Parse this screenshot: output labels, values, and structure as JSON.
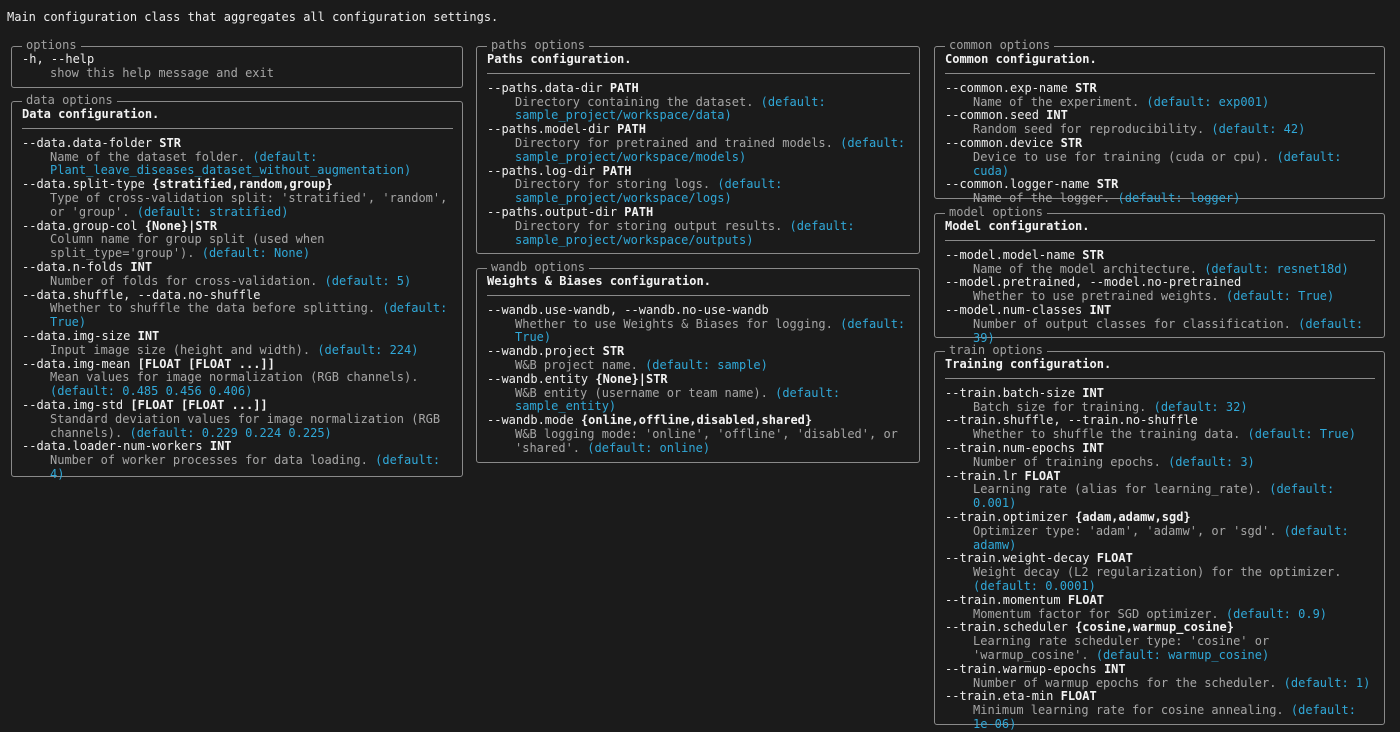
{
  "intro": "Main configuration class that aggregates all configuration settings.",
  "colors": {
    "background": "#1b1b1b",
    "text": "#dcdcdc",
    "default": "#30a8d8",
    "border": "#8a8a8a"
  },
  "options": {
    "title": "options",
    "items": [
      {
        "flag": "-h, --help",
        "metavar": "",
        "help": "show this help message and exit",
        "def": ""
      }
    ]
  },
  "data": {
    "title": "data options",
    "description": "Data configuration.",
    "items": [
      {
        "flag": "--data.data-folder",
        "metavar": "STR",
        "help": "Name of the dataset folder.",
        "def": "(default: Plant_leave_diseases_dataset_without_augmentation)"
      },
      {
        "flag": "--data.split-type",
        "metavar": "{stratified,random,group}",
        "help": "Type of cross-validation split: 'stratified', 'random', or 'group'.",
        "def": "(default: stratified)"
      },
      {
        "flag": "--data.group-col",
        "metavar": "{None}|STR",
        "help": "Column name for group split (used when split_type='group').",
        "def": "(default: None)"
      },
      {
        "flag": "--data.n-folds",
        "metavar": "INT",
        "help": "Number of folds for cross-validation.",
        "def": "(default: 5)"
      },
      {
        "flag": "--data.shuffle, --data.no-shuffle",
        "metavar": "",
        "help": "Whether to shuffle the data before splitting.",
        "def": "(default: True)"
      },
      {
        "flag": "--data.img-size",
        "metavar": "INT",
        "help": "Input image size (height and width).",
        "def": "(default: 224)"
      },
      {
        "flag": "--data.img-mean",
        "metavar": "[FLOAT [FLOAT ...]]",
        "help": "Mean values for image normalization (RGB channels).",
        "def": "(default: 0.485 0.456 0.406)"
      },
      {
        "flag": "--data.img-std",
        "metavar": "[FLOAT [FLOAT ...]]",
        "help": "Standard deviation values for image normalization (RGB channels).",
        "def": "(default: 0.229 0.224 0.225)"
      },
      {
        "flag": "--data.loader-num-workers",
        "metavar": "INT",
        "help": "Number of worker processes for data loading.",
        "def": "(default: 4)"
      }
    ]
  },
  "paths": {
    "title": "paths options",
    "description": "Paths configuration.",
    "items": [
      {
        "flag": "--paths.data-dir",
        "metavar": "PATH",
        "help": "Directory containing the dataset.",
        "def": "(default: sample_project/workspace/data)"
      },
      {
        "flag": "--paths.model-dir",
        "metavar": "PATH",
        "help": "Directory for pretrained and trained models.",
        "def": "(default: sample_project/workspace/models)"
      },
      {
        "flag": "--paths.log-dir",
        "metavar": "PATH",
        "help": "Directory for storing logs.",
        "def": "(default: sample_project/workspace/logs)"
      },
      {
        "flag": "--paths.output-dir",
        "metavar": "PATH",
        "help": "Directory for storing output results.",
        "def": "(default: sample_project/workspace/outputs)"
      }
    ]
  },
  "wandb": {
    "title": "wandb options",
    "description": "Weights & Biases configuration.",
    "items": [
      {
        "flag": "--wandb.use-wandb, --wandb.no-use-wandb",
        "metavar": "",
        "help": "Whether to use Weights & Biases for logging.",
        "def": "(default: True)"
      },
      {
        "flag": "--wandb.project",
        "metavar": "STR",
        "help": "W&B project name.",
        "def": "(default: sample)"
      },
      {
        "flag": "--wandb.entity",
        "metavar": "{None}|STR",
        "help": "W&B entity (username or team name).",
        "def": "(default: sample_entity)"
      },
      {
        "flag": "--wandb.mode",
        "metavar": "{online,offline,disabled,shared}",
        "help": "W&B logging mode: 'online', 'offline', 'disabled', or 'shared'.",
        "def": "(default: online)"
      }
    ]
  },
  "common": {
    "title": "common options",
    "description": "Common configuration.",
    "items": [
      {
        "flag": "--common.exp-name",
        "metavar": "STR",
        "help": "Name of the experiment.",
        "def": "(default: exp001)"
      },
      {
        "flag": "--common.seed",
        "metavar": "INT",
        "help": "Random seed for reproducibility.",
        "def": "(default: 42)"
      },
      {
        "flag": "--common.device",
        "metavar": "STR",
        "help": "Device to use for training (cuda or cpu).",
        "def": "(default: cuda)"
      },
      {
        "flag": "--common.logger-name",
        "metavar": "STR",
        "help": "Name of the logger.",
        "def": "(default: logger)"
      }
    ]
  },
  "model": {
    "title": "model options",
    "description": "Model configuration.",
    "items": [
      {
        "flag": "--model.model-name",
        "metavar": "STR",
        "help": "Name of the model architecture.",
        "def": "(default: resnet18d)"
      },
      {
        "flag": "--model.pretrained, --model.no-pretrained",
        "metavar": "",
        "help": "Whether to use pretrained weights.",
        "def": "(default: True)"
      },
      {
        "flag": "--model.num-classes",
        "metavar": "INT",
        "help": "Number of output classes for classification.",
        "def": "(default: 39)"
      }
    ]
  },
  "train": {
    "title": "train options",
    "description": "Training configuration.",
    "items": [
      {
        "flag": "--train.batch-size",
        "metavar": "INT",
        "help": "Batch size for training.",
        "def": "(default: 32)"
      },
      {
        "flag": "--train.shuffle, --train.no-shuffle",
        "metavar": "",
        "help": "Whether to shuffle the training data.",
        "def": "(default: True)"
      },
      {
        "flag": "--train.num-epochs",
        "metavar": "INT",
        "help": "Number of training epochs.",
        "def": "(default: 3)"
      },
      {
        "flag": "--train.lr",
        "metavar": "FLOAT",
        "help": "Learning rate (alias for learning_rate).",
        "def": "(default: 0.001)"
      },
      {
        "flag": "--train.optimizer",
        "metavar": "{adam,adamw,sgd}",
        "help": "Optimizer type: 'adam', 'adamw', or 'sgd'.",
        "def": "(default: adamw)"
      },
      {
        "flag": "--train.weight-decay",
        "metavar": "FLOAT",
        "help": "Weight decay (L2 regularization) for the optimizer.",
        "def": "(default: 0.0001)"
      },
      {
        "flag": "--train.momentum",
        "metavar": "FLOAT",
        "help": "Momentum factor for SGD optimizer.",
        "def": "(default: 0.9)"
      },
      {
        "flag": "--train.scheduler",
        "metavar": "{cosine,warmup_cosine}",
        "help": "Learning rate scheduler type: 'cosine' or 'warmup_cosine'.",
        "def": "(default: warmup_cosine)"
      },
      {
        "flag": "--train.warmup-epochs",
        "metavar": "INT",
        "help": "Number of warmup epochs for the scheduler.",
        "def": "(default: 1)"
      },
      {
        "flag": "--train.eta-min",
        "metavar": "FLOAT",
        "help": "Minimum learning rate for cosine annealing.",
        "def": "(default: 1e-06)"
      }
    ]
  }
}
